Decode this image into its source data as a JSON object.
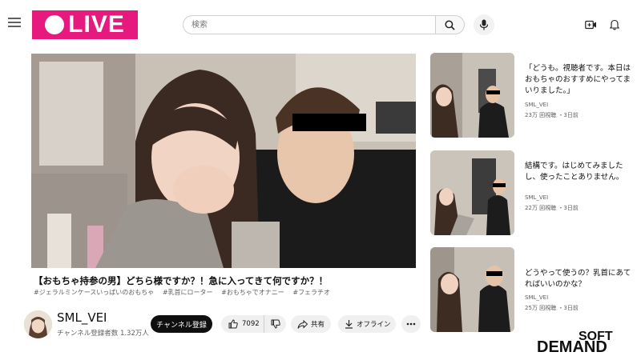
{
  "logo": {
    "text": "LIVE",
    "color": "#e5197e"
  },
  "header": {
    "menu_icon": "hamburger-menu-icon",
    "search_placeholder": "検索",
    "search_icon": "magnifier-icon",
    "mic_icon": "microphone-icon",
    "create_icon": "video-camera-plus-icon",
    "notifications_icon": "bell-icon"
  },
  "video": {
    "title": "【おもちゃ持参の男】どちら様ですか？！急に入ってきて何ですか？！",
    "hashtags": [
      "#ジェラルミンケースいっぱいのおもちゃ",
      "#乳首にローター",
      "#おもちゃでオナニー",
      "#フェラチオ"
    ]
  },
  "channel": {
    "name": "SML_VEI",
    "subscribers": "チャンネル登録者数 1.32万人",
    "subscribe_label": "チャンネル登録"
  },
  "actions": {
    "like_count": "7092",
    "share_label": "共有",
    "offline_label": "オフライン"
  },
  "recommendations": [
    {
      "title": "「どうも。視聴者です。本日はおもちゃのおすすめにやってまいりました。」",
      "channel": "SML_VEI",
      "views": "23万 回視聴",
      "age": "3日前"
    },
    {
      "title": "結構です。はじめてみましたし、使ったことありません。",
      "channel": "SML_VEI",
      "views": "22万 回視聴",
      "age": "3日前"
    },
    {
      "title": "どうやって使うの？乳首にあてればいいのかな？",
      "channel": "SML_VEI",
      "views": "25万 回視聴",
      "age": "3日前"
    }
  ],
  "brand": {
    "top": "SOFT",
    "bottom": "DEMAND",
    "accent": "#e60012"
  }
}
